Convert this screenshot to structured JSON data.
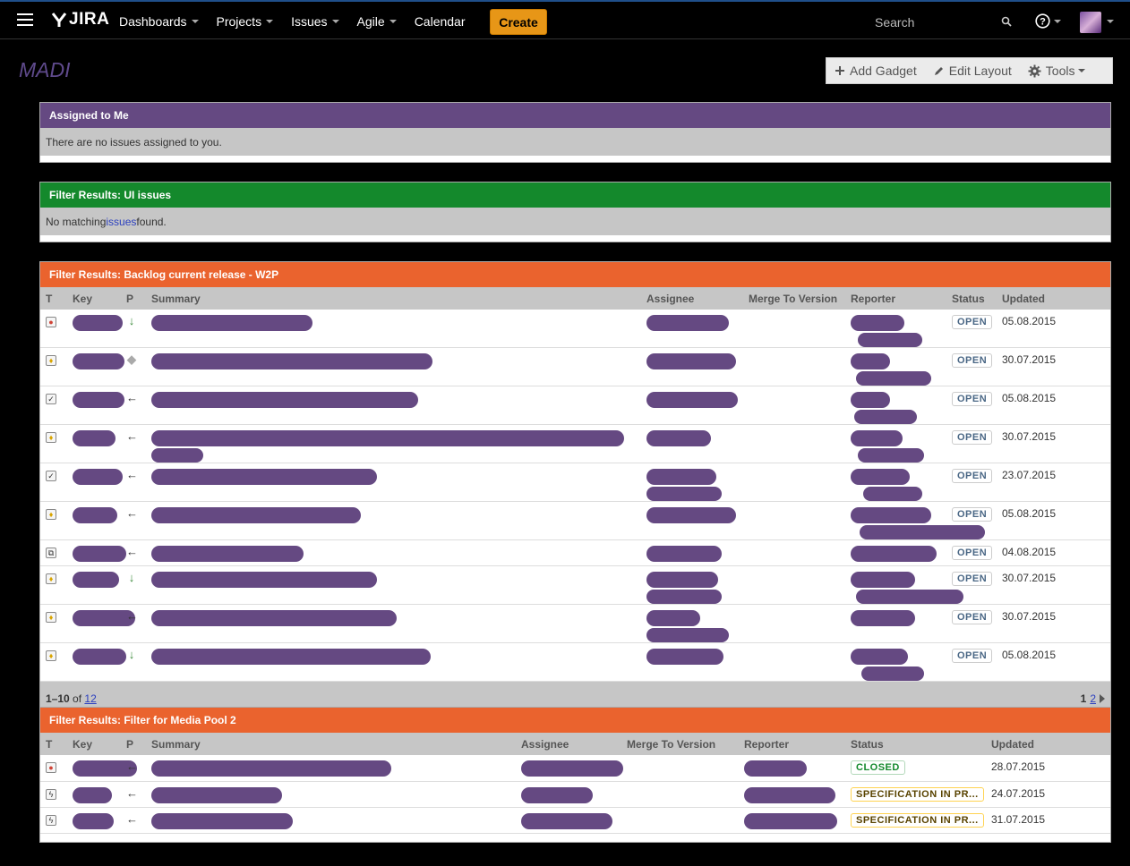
{
  "topbar": {
    "logo_text": "JIRA",
    "nav": [
      "Dashboards",
      "Projects",
      "Issues",
      "Agile",
      "Calendar"
    ],
    "create_label": "Create",
    "search_placeholder": "Search"
  },
  "page": {
    "title": "MADI",
    "toolbar": {
      "add_gadget": "Add Gadget",
      "edit_layout": "Edit Layout",
      "tools": "Tools"
    }
  },
  "gadgets": {
    "assigned": {
      "title": "Assigned to Me",
      "message": "There are no issues assigned to you."
    },
    "ui_issues": {
      "title": "Filter Results: UI issues",
      "msg_before": "No matching ",
      "msg_link": "issues",
      "msg_after": " found."
    },
    "backlog": {
      "title": "Filter Results: Backlog current release - W2P",
      "columns": [
        "T",
        "Key",
        "P",
        "Summary",
        "Assignee",
        "Merge To Version",
        "Reporter",
        "Status",
        "Updated"
      ],
      "rows": [
        {
          "status": "OPEN",
          "updated": "05.08.2015"
        },
        {
          "status": "OPEN",
          "updated": "30.07.2015"
        },
        {
          "status": "OPEN",
          "updated": "05.08.2015"
        },
        {
          "status": "OPEN",
          "updated": "30.07.2015"
        },
        {
          "status": "OPEN",
          "updated": "23.07.2015"
        },
        {
          "status": "OPEN",
          "updated": "05.08.2015"
        },
        {
          "status": "OPEN",
          "updated": "04.08.2015"
        },
        {
          "status": "OPEN",
          "updated": "30.07.2015"
        },
        {
          "status": "OPEN",
          "updated": "30.07.2015"
        },
        {
          "status": "OPEN",
          "updated": "05.08.2015"
        }
      ],
      "pager": {
        "range": "1–10",
        "of": "of",
        "total": "12",
        "page_current": "1",
        "page_next": "2"
      }
    },
    "media_pool": {
      "title": "Filter Results: Filter for Media Pool 2",
      "columns": [
        "T",
        "Key",
        "P",
        "Summary",
        "Assignee",
        "Merge To Version",
        "Reporter",
        "Status",
        "Updated"
      ],
      "rows": [
        {
          "status": "CLOSED",
          "updated": "28.07.2015"
        },
        {
          "status": "SPECIFICATION IN PR...",
          "updated": "24.07.2015"
        },
        {
          "status": "SPECIFICATION IN PR...",
          "updated": "31.07.2015"
        }
      ]
    }
  },
  "colors": {
    "purple": "#654982",
    "green": "#14892c",
    "orange": "#ea632e",
    "create": "#e79617"
  }
}
